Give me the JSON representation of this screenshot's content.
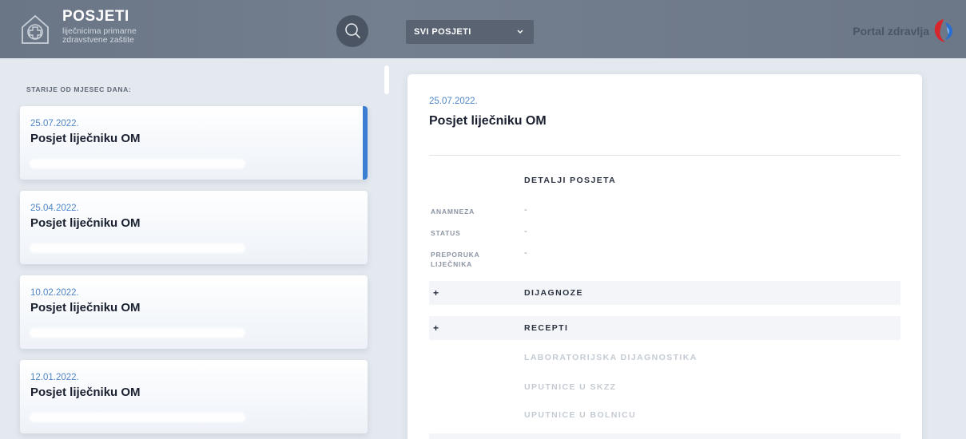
{
  "header": {
    "title": "POSJETI",
    "subtitle": "liječnicima primarne zdravstvene zaštite",
    "filter": {
      "selected": "SVI POSJETI"
    },
    "portal_name": "Portal zdravlja",
    "icons": {
      "logo": "medical-house-icon",
      "search": "search-icon",
      "dropdown": "chevron-down-icon",
      "portal_logo": "portal-logo"
    },
    "colors": {
      "header_bg": "#6f7a8a",
      "accent_blue": "#3c7fd2",
      "portal_red": "#d8242b"
    }
  },
  "list": {
    "heading": "STARIJE OD MJESEC DANA:",
    "items": [
      {
        "date": "25.07.2022.",
        "title": "Posjet liječniku OM"
      },
      {
        "date": "25.04.2022.",
        "title": "Posjet liječniku OM"
      },
      {
        "date": "10.02.2022.",
        "title": "Posjet liječniku OM"
      },
      {
        "date": "12.01.2022.",
        "title": "Posjet liječniku OM"
      }
    ]
  },
  "detail": {
    "date": "25.07.2022.",
    "title": "Posjet liječniku OM",
    "section_title": "DETALJI POSJETA",
    "fields": [
      {
        "label": "ANAMNEZA",
        "value": "-"
      },
      {
        "label": "STATUS",
        "value": "-"
      },
      {
        "label": "PREPORUKA LIJEČNIKA",
        "value": "-"
      }
    ],
    "accordions": [
      {
        "toggle": "+",
        "label": "DIJAGNOZE"
      },
      {
        "toggle": "+",
        "label": "RECEPTI"
      }
    ],
    "disabled_sections": [
      "LABORATORIJSKA DIJAGNOSTIKA",
      "UPUTNICE U SKZZ",
      "UPUTNICE U BOLNICU"
    ]
  }
}
